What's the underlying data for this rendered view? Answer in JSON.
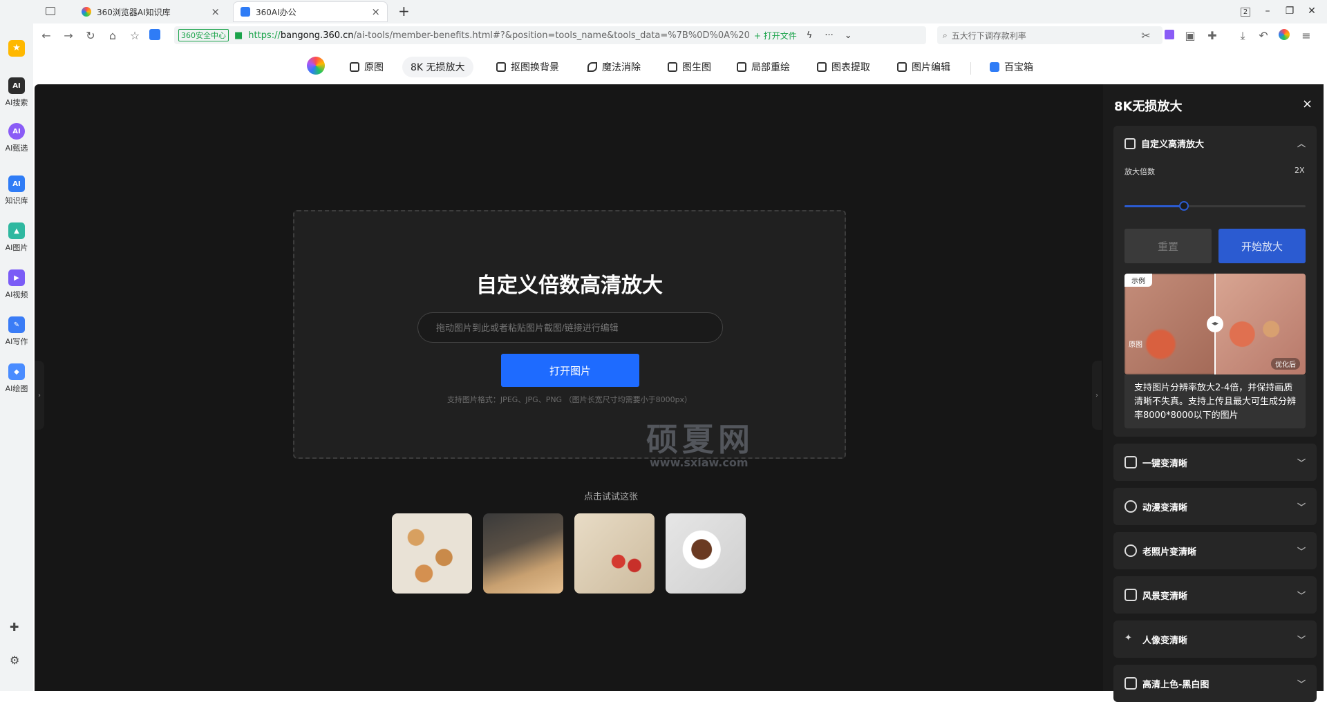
{
  "browser": {
    "tabs": [
      {
        "title": "360浏览器AI知识库"
      },
      {
        "title": "360AI办公"
      }
    ],
    "new_tab": "+",
    "tab_count_badge": "2",
    "url": {
      "security_badge": "360安全中心",
      "scheme": "https://",
      "host": "bangong.360.cn",
      "path": "/ai-tools/member-benefits.html#?&position=tools_name&tools_data=%7B%0D%0A%20",
      "open_file": "+ 打开文件"
    },
    "search_placeholder": "五大行下调存款利率"
  },
  "sidebar": {
    "items": [
      {
        "label": "AI搜索",
        "color": "#2d2d2d"
      },
      {
        "label": "AI甄选",
        "color": "#8a5cf6"
      },
      {
        "label": "知识库",
        "color": "#2f7cf6"
      },
      {
        "label": "AI图片",
        "color": "#2fb8a0"
      },
      {
        "label": "AI视频",
        "color": "#7a5cf6"
      },
      {
        "label": "AI写作",
        "color": "#3a7cf6"
      },
      {
        "label": "AI绘图",
        "color": "#4a8cff"
      }
    ]
  },
  "tools": {
    "items": [
      {
        "label": "原图",
        "active": false
      },
      {
        "label": "8K 无损放大",
        "active": true
      },
      {
        "label": "抠图换背景",
        "active": false
      },
      {
        "label": "魔法消除",
        "active": false
      },
      {
        "label": "图生图",
        "active": false
      },
      {
        "label": "局部重绘",
        "active": false
      },
      {
        "label": "图表提取",
        "active": false
      },
      {
        "label": "图片编辑",
        "active": false
      },
      {
        "label": "百宝箱",
        "active": false
      }
    ]
  },
  "main": {
    "title": "自定义倍数高清放大",
    "input_placeholder": "拖动图片到此或者粘贴图片截图/链接进行编辑",
    "open_button": "打开图片",
    "hint": "支持图片格式：JPEG、JPG、PNG （图片长宽尺寸均需要小于8000px）",
    "try_label": "点击试试这张",
    "watermark_cn": "硕夏网",
    "watermark_en": "www.sxiaw.com"
  },
  "panel": {
    "title": "8K无损放大",
    "close": "×",
    "custom_section": "自定义高清放大",
    "scale_label": "放大倍数",
    "scale_value": "2X",
    "scale_fraction": 0.33,
    "reset_button": "重置",
    "start_button": "开始放大",
    "example_tag": "示例",
    "before_tag": "原图",
    "after_tag": "优化后",
    "description": "支持图片分辨率放大2-4倍，并保持画质清晰不失真。支持上传且最大可生成分辨率8000*8000以下的图片",
    "sections": [
      {
        "label": "一键变清晰"
      },
      {
        "label": "动漫变清晰"
      },
      {
        "label": "老照片变清晰"
      },
      {
        "label": "风景变清晰"
      },
      {
        "label": "人像变清晰"
      },
      {
        "label": "高清上色-黑白图"
      }
    ]
  },
  "colors": {
    "accent_blue": "#1e6bff",
    "panel_blue": "#2b5bd1",
    "secure_green": "#1aa34a"
  }
}
